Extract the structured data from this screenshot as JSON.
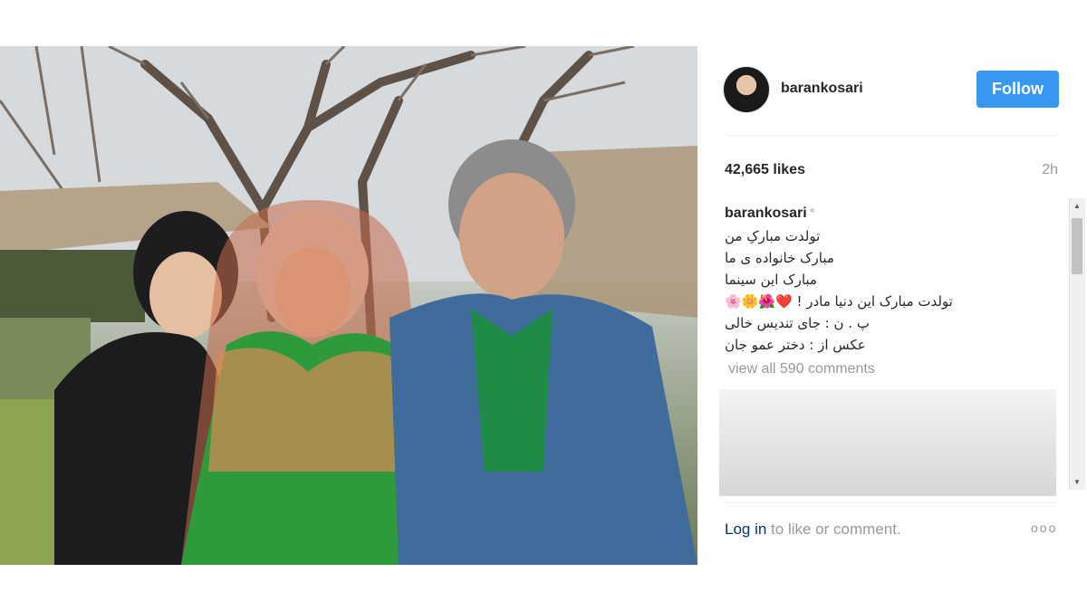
{
  "header": {
    "username": "barankosari",
    "follow_label": "Follow"
  },
  "stats": {
    "likes": "42,665 likes",
    "timestamp": "2h"
  },
  "caption": {
    "author": "barankosari",
    "verified_mark": "°",
    "lines": [
      "تولدت مبارکِ من",
      "مبارک خانواده ی ما",
      "مبارک این سینما",
      "تولدت مبارک این دنیا مادر ! ❤️🌺🌼🌸",
      "پ . ن : جای تندیس خالی",
      "عکس از : دختر عمو جان"
    ]
  },
  "comments": {
    "view_all": "view all 590 comments"
  },
  "footer": {
    "login_label": "Log in",
    "login_suffix": " to like or comment.",
    "more_icon": "ooo"
  },
  "colors": {
    "follow_button": "#3897f0",
    "link": "#003569",
    "muted": "#999999"
  },
  "icons": {
    "scroll_up": "up-triangle",
    "scroll_down": "down-triangle",
    "more": "three-dots"
  }
}
